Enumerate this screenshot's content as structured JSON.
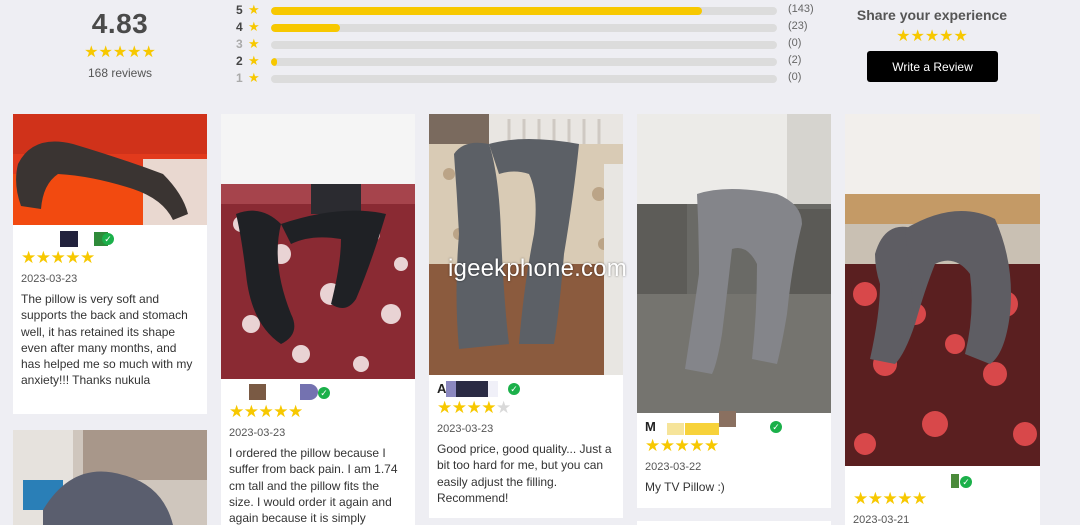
{
  "summary": {
    "average": "4.83",
    "stars": "★★★★★",
    "count_label": "168 reviews"
  },
  "breakdown": [
    {
      "level": "5",
      "count": "(143)",
      "fraction": 0.851
    },
    {
      "level": "4",
      "count": "(23)",
      "fraction": 0.137
    },
    {
      "level": "3",
      "count": "(0)",
      "fraction": 0
    },
    {
      "level": "2",
      "count": "(2)",
      "fraction": 0.012
    },
    {
      "level": "1",
      "count": "(0)",
      "fraction": 0
    }
  ],
  "share": {
    "title": "Share your experience",
    "stars": "★★★★★",
    "button_label": "Write a Review"
  },
  "reviews": [
    {
      "rating": 5,
      "date": "2023-03-23",
      "text": "The pillow is very soft and supports the back and stomach well, it has retained its shape even after many months, and has helped me so much with my anxiety!!! Thanks nukula"
    },
    {
      "rating": 5,
      "date": "2023-03-23",
      "text": "I ordered the pillow because I suffer from back pain. I am 1.74 cm tall and the pillow fits the size. I would order it again and again because it is simply"
    },
    {
      "rating": 4,
      "name_initial": "A",
      "date": "2023-03-23",
      "text": "Good price, good quality... Just a bit too hard for me, but you can easily adjust the filling. Recommend!"
    },
    {
      "rating": 5,
      "name_initial": "M",
      "date": "2023-03-22",
      "text": "My TV Pillow :)"
    },
    {
      "rating": 5,
      "date": "2023-03-21"
    }
  ],
  "watermark": "igeekphone.com",
  "colors": {
    "star": "#f7c800",
    "verified": "#1bb04a",
    "button": "#000000",
    "page_bg": "#eeeef3"
  }
}
